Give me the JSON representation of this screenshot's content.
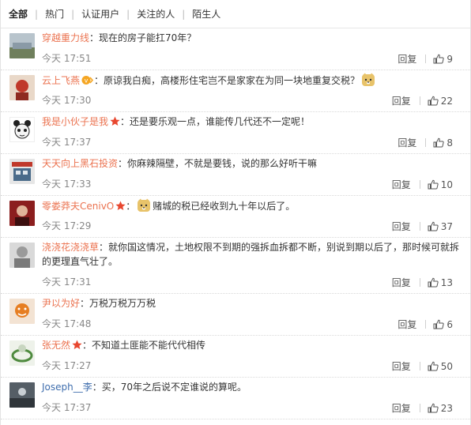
{
  "tabs": [
    "全部",
    "热门",
    "认证用户",
    "关注的人",
    "陌生人"
  ],
  "reply_label": "回复",
  "comments": [
    {
      "user": "穿越重力线",
      "text": "现在的房子能扛70年？",
      "time": "今天 17:51",
      "likes": "9"
    },
    {
      "user": "云上飞燕",
      "text": "原谅我白痴，高楼形住宅岂不是家家在为同一块地重复交税？",
      "time": "今天 17:30",
      "likes": "22"
    },
    {
      "user": "我是小伙子是我",
      "text": "还是要乐观一点，谁能传几代还不一定呢！",
      "time": "今天 17:37",
      "likes": "8"
    },
    {
      "user": "天天向上黑石投资",
      "text": "你麻辣隔壁，不就是要钱，说的那么好听干嘛",
      "time": "今天 17:33",
      "likes": "10"
    },
    {
      "user": "零娄莽夫CenivO",
      "text": "赌城的税已经收到九十年以后了。",
      "time": "今天 17:29",
      "likes": "37"
    },
    {
      "user": "浇浇花浇浇草",
      "text": "就你国这情况，土地权限不到期的强拆血拆都不断，别说到期以后了，那时候可就拆的更理直气壮了。",
      "time": "今天 17:31",
      "likes": "13"
    },
    {
      "user": "尹以为好",
      "text": "万税万税万万税",
      "time": "今天 17:48",
      "likes": "6"
    },
    {
      "user": "张无然",
      "text": "不知道土匪能不能代代相传",
      "time": "今天 17:27",
      "likes": "50"
    },
    {
      "user": "Joseph__李",
      "text": "买，70年之后说不定谁说的算呢。",
      "time": "今天 17:37",
      "likes": "23"
    }
  ]
}
